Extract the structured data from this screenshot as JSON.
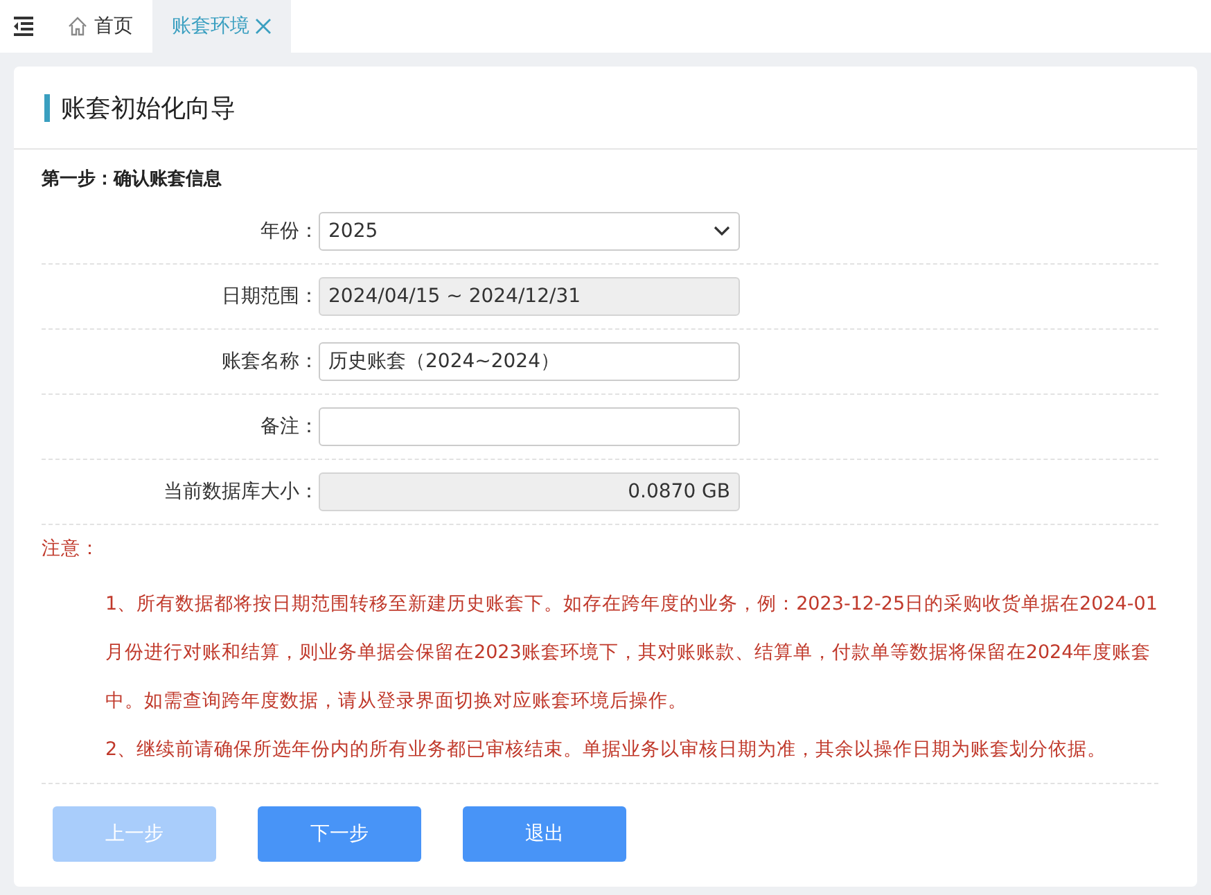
{
  "tabs": [
    {
      "label": "首页",
      "kind": "home",
      "selected": false,
      "closable": false
    },
    {
      "label": "账套环境",
      "kind": "plain",
      "selected": true,
      "closable": true
    }
  ],
  "panel": {
    "title": "账套初始化向导",
    "step": "第一步：确认账套信息",
    "fields": [
      {
        "label": "年份：",
        "kind": "select",
        "value": "2025",
        "disabled": false
      },
      {
        "label": "日期范围：",
        "kind": "text",
        "value": "2024/04/15 ~ 2024/12/31",
        "disabled": true
      },
      {
        "label": "账套名称：",
        "kind": "text",
        "value": "历史账套（2024~2024）",
        "disabled": false
      },
      {
        "label": "备注：",
        "kind": "text",
        "disabled": false
      },
      {
        "label": "当前数据库大小：",
        "kind": "number",
        "value": "0.0870 GB",
        "disabled": true
      }
    ],
    "notice": {
      "title": "注意：",
      "items": [
        "1、所有数据都将按日期范围转移至新建历史账套下。如存在跨年度的业务，例：2023-12-25日的采购收货单据在2024-01月份进行对账和结算，则业务单据会保留在2023账套环境下，其对账账款、结算单，付款单等数据将保留在2024年度账套中。如需查询跨年度数据，请从登录界面切换对应账套环境后操作。",
        "2、继续前请确保所选年份内的所有业务都已审核结束。单据业务以审核日期为准，其余以操作日期为账套划分依据。"
      ]
    },
    "buttons": [
      {
        "label": "上一步",
        "disabled": true
      },
      {
        "label": "下一步",
        "disabled": false
      },
      {
        "label": "退出",
        "disabled": false
      }
    ]
  }
}
